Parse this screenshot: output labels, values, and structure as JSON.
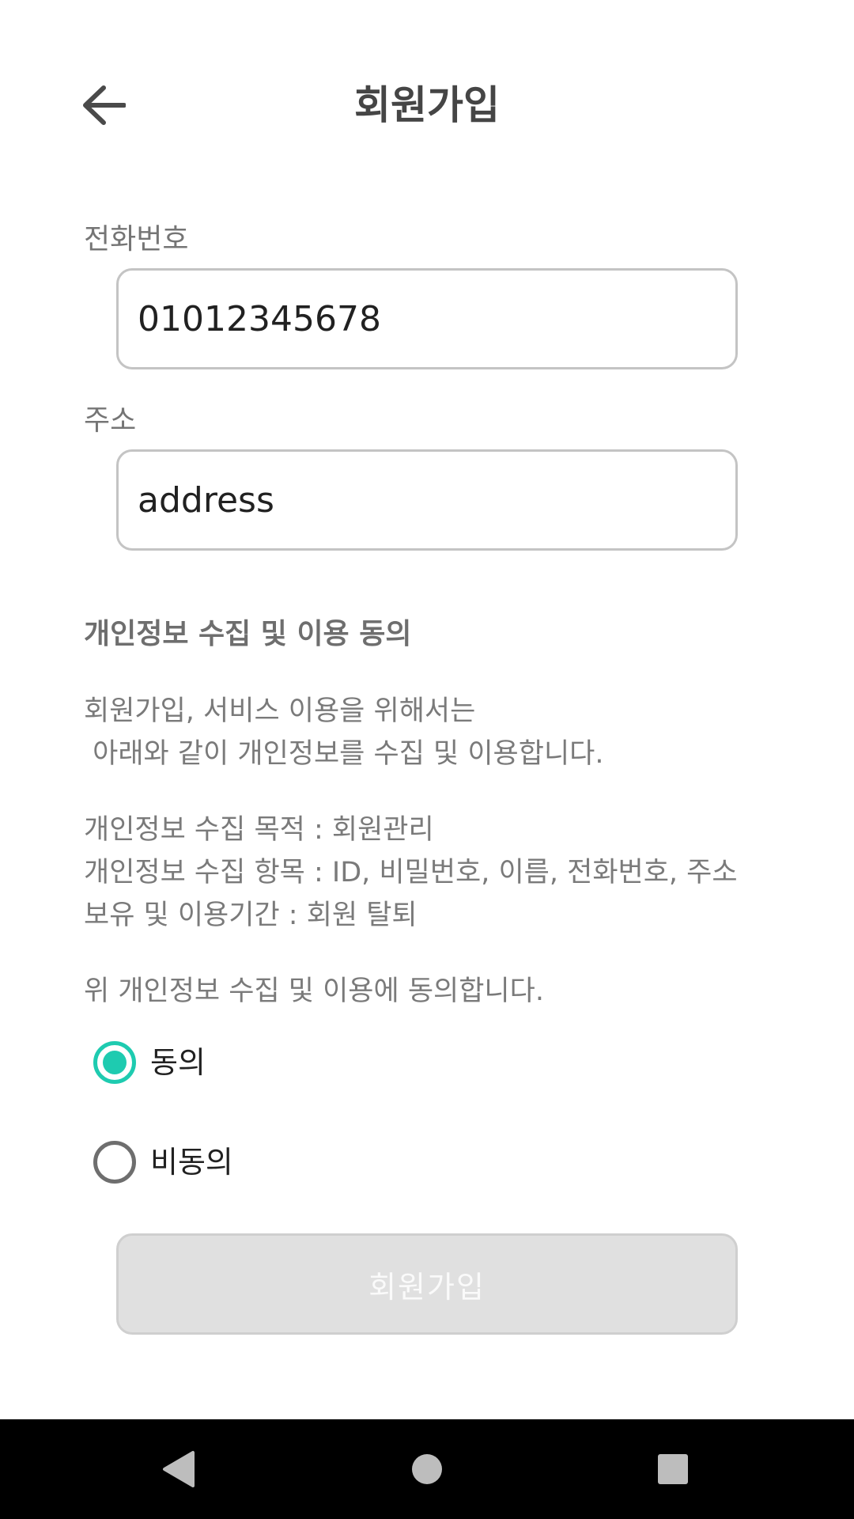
{
  "header": {
    "title": "회원가입",
    "back_icon": "arrow-left-icon"
  },
  "form": {
    "phone": {
      "label": "전화번호",
      "value": "01012345678"
    },
    "address": {
      "label": "주소",
      "value": "address"
    }
  },
  "privacy": {
    "title": "개인정보 수집 및 이용 동의",
    "intro": "회원가입, 서비스 이용을 위해서는\n 아래와 같이 개인정보를 수집 및 이용합니다.",
    "details": "개인정보 수집 목적 : 회원관리\n개인정보 수집 항목 : ID, 비밀번호, 이름, 전화번호, 주소\n보유 및 이용기간 : 회원 탈퇴",
    "question": "위 개인정보 수집 및 이용에 동의합니다.",
    "options": [
      {
        "label": "동의",
        "checked": true
      },
      {
        "label": "비동의",
        "checked": false
      }
    ]
  },
  "submit": {
    "label": "회원가입",
    "enabled": false
  },
  "colors": {
    "accent": "#1ecbb0",
    "disabled_button": "#e0e0e0",
    "nav_bar": "#000000"
  },
  "system_nav": {
    "back_icon": "nav-back-triangle-icon",
    "home_icon": "nav-home-circle-icon",
    "recents_icon": "nav-recents-square-icon"
  }
}
